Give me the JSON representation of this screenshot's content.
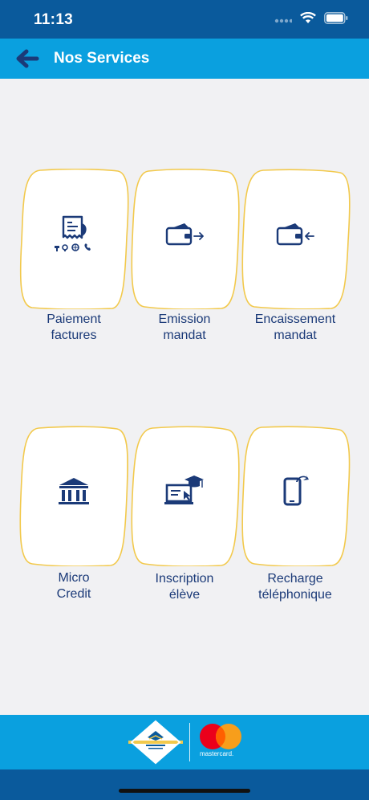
{
  "status_bar": {
    "time": "11:13"
  },
  "header": {
    "title": "Nos Services"
  },
  "services": [
    {
      "line1": "Paiement",
      "line2": "factures",
      "icon": "bill-payment-icon"
    },
    {
      "line1": "Emission",
      "line2": "mandat",
      "icon": "wallet-send-icon"
    },
    {
      "line1": "Encaissement",
      "line2": "mandat",
      "icon": "wallet-receive-icon"
    },
    {
      "line1": "Micro",
      "line2": "Credit",
      "icon": "bank-icon"
    },
    {
      "line1": "Inscription",
      "line2": "élève",
      "icon": "graduation-laptop-icon"
    },
    {
      "line1": "Recharge",
      "line2": "téléphonique",
      "icon": "phone-recharge-icon"
    }
  ],
  "footer": {
    "partner": "mastercard."
  },
  "colors": {
    "status_bg": "#0a5a9c",
    "header_bg": "#0aa0df",
    "tile_border": "#f2c94c",
    "icon_blue": "#1b3a78",
    "background": "#f1f1f3"
  }
}
